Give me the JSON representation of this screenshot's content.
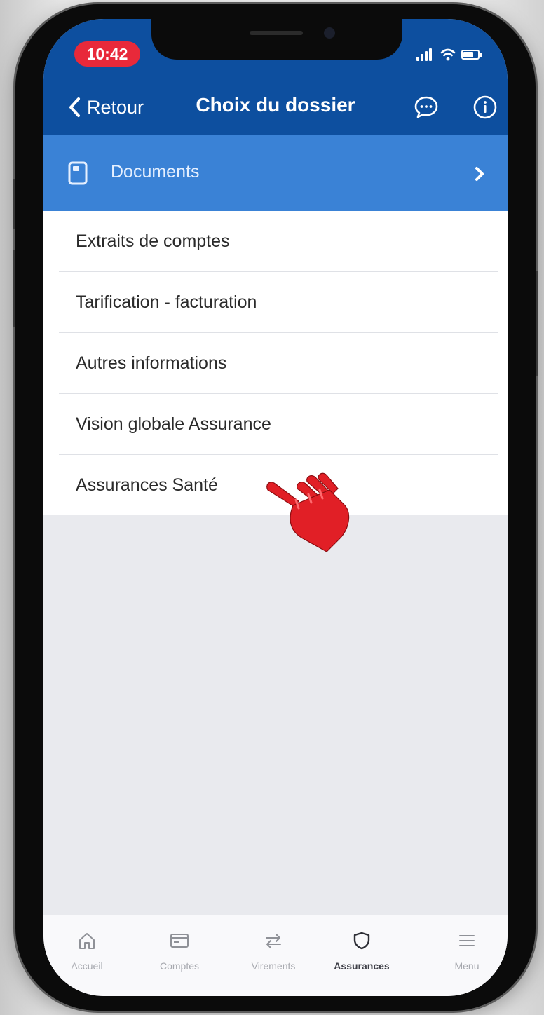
{
  "status_bar": {
    "time": "10:42"
  },
  "nav": {
    "back_label": "Retour",
    "title": "Choix du dossier",
    "chat_icon": "chat-bubble-icon",
    "info_icon": "info-icon"
  },
  "documents_row": {
    "label": "Documents",
    "icon": "document-icon"
  },
  "items": [
    {
      "label": "Extraits de comptes"
    },
    {
      "label": "Tarification - facturation"
    },
    {
      "label": "Autres informations"
    },
    {
      "label": "Vision globale Assurance"
    },
    {
      "label": "Assurances Santé"
    }
  ],
  "tabs": [
    {
      "label": "Accueil",
      "icon": "home-icon"
    },
    {
      "label": "Comptes",
      "icon": "card-icon"
    },
    {
      "label": "Virements",
      "icon": "transfer-icon"
    },
    {
      "label": "Assurances",
      "icon": "shield-icon",
      "active": true
    },
    {
      "label": "Menu",
      "icon": "menu-icon"
    }
  ],
  "colors": {
    "header_blue": "#0d4f9f",
    "documents_blue": "#3a82d6",
    "time_pill_red": "#e8293a",
    "hand_red": "#e11f26"
  }
}
